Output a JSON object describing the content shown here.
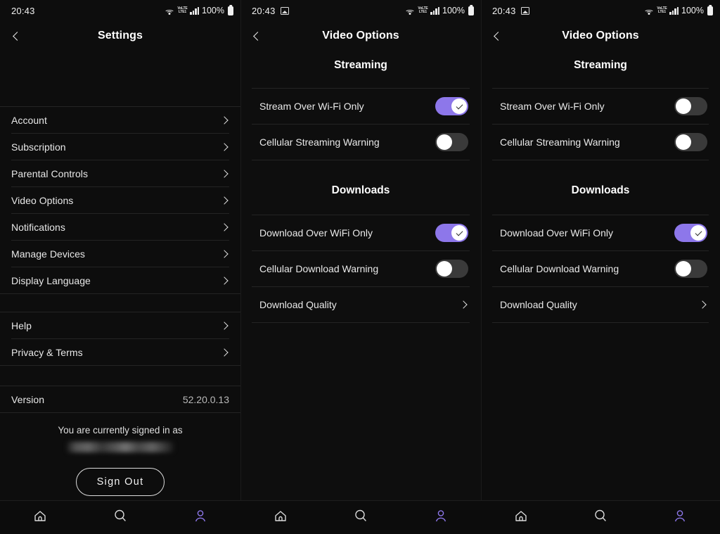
{
  "status_bar": {
    "time": "20:43",
    "battery_percent": "100%",
    "icons": [
      "screenshot-icon",
      "wifi-icon",
      "volte-icon",
      "signal-bars-icon",
      "battery-icon"
    ],
    "volte_top": "VoLTE",
    "volte_bottom": "LTE1"
  },
  "colors": {
    "accent_purple": "#8d77ea",
    "background": "#0d0d0d",
    "divider": "#242424",
    "toggle_off": "#3a3a3a",
    "text_primary": "#e8e8e8"
  },
  "panels": [
    {
      "id": "settings",
      "nav_title": "Settings",
      "back_label": "Back",
      "groups": [
        {
          "items": [
            {
              "label": "Account",
              "type": "chevron"
            },
            {
              "label": "Subscription",
              "type": "chevron"
            },
            {
              "label": "Parental Controls",
              "type": "chevron"
            },
            {
              "label": "Video Options",
              "type": "chevron"
            },
            {
              "label": "Notifications",
              "type": "chevron"
            },
            {
              "label": "Manage Devices",
              "type": "chevron"
            },
            {
              "label": "Display Language",
              "type": "chevron"
            }
          ]
        },
        {
          "items": [
            {
              "label": "Help",
              "type": "chevron"
            },
            {
              "label": "Privacy & Terms",
              "type": "chevron"
            }
          ]
        },
        {
          "items": [
            {
              "label": "Version",
              "type": "value",
              "value": "52.20.0.13"
            }
          ]
        }
      ],
      "account": {
        "signed_in_text": "You are currently signed in as",
        "email_redacted": "",
        "sign_out_label": "Sign Out"
      }
    },
    {
      "id": "video-options-a",
      "nav_title": "Video Options",
      "back_label": "Back",
      "sections": [
        {
          "heading": "Streaming",
          "toggles": [
            {
              "label": "Stream Over Wi-Fi Only",
              "state": "on"
            },
            {
              "label": "Cellular Streaming Warning",
              "state": "off"
            }
          ]
        },
        {
          "heading": "Downloads",
          "toggles": [
            {
              "label": "Download Over WiFi Only",
              "state": "on"
            },
            {
              "label": "Cellular Download Warning",
              "state": "off"
            }
          ],
          "link_row": {
            "label": "Download Quality",
            "type": "chevron"
          }
        }
      ]
    },
    {
      "id": "video-options-b",
      "nav_title": "Video Options",
      "back_label": "Back",
      "sections": [
        {
          "heading": "Streaming",
          "toggles": [
            {
              "label": "Stream Over Wi-Fi Only",
              "state": "off"
            },
            {
              "label": "Cellular Streaming Warning",
              "state": "off"
            }
          ]
        },
        {
          "heading": "Downloads",
          "toggles": [
            {
              "label": "Download Over WiFi Only",
              "state": "on"
            },
            {
              "label": "Cellular Download Warning",
              "state": "off"
            }
          ],
          "link_row": {
            "label": "Download Quality",
            "type": "chevron"
          }
        }
      ]
    }
  ],
  "bottom_nav": {
    "items": [
      {
        "icon": "home-icon",
        "active": false
      },
      {
        "icon": "search-icon",
        "active": false
      },
      {
        "icon": "person-icon",
        "active": true
      }
    ]
  }
}
